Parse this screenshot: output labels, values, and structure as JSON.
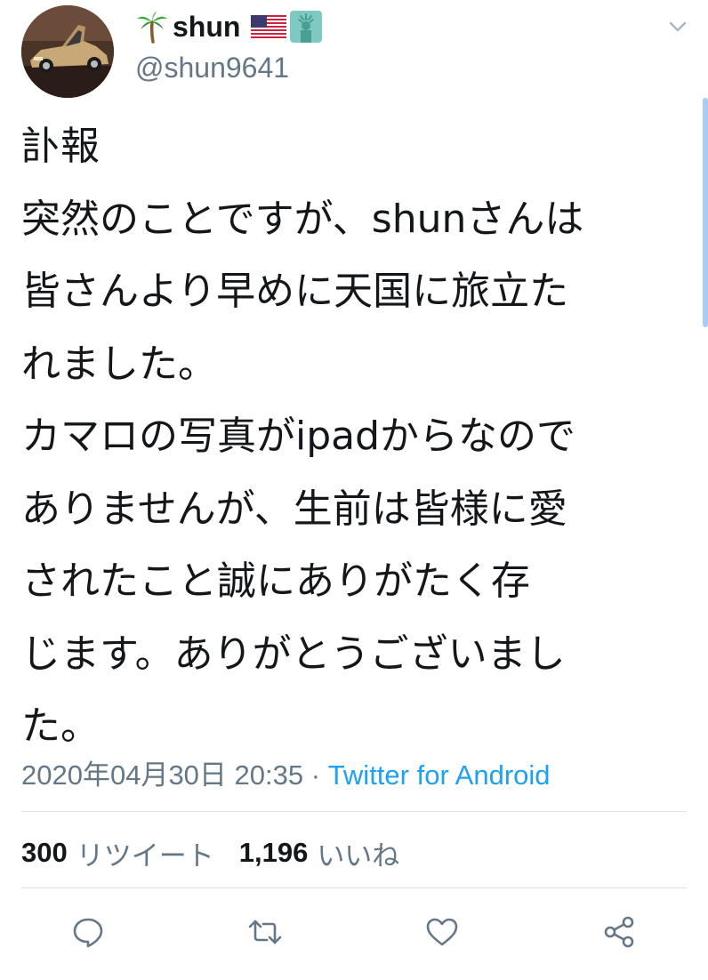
{
  "header": {
    "display_name": "shun",
    "handle": "@shun9641",
    "name_emoji": [
      "palm-tree",
      "us-flag",
      "statue-of-liberty"
    ]
  },
  "tweet": {
    "lines": [
      "訃報",
      "突然のことですが、shunさんは",
      "皆さんより早めに天国に旅立た",
      "れました。",
      "カマロの写真がipadからなので",
      "ありませんが、生前は皆様に愛",
      "されたこと誠にありがたく存",
      "じます。ありがとうございまし",
      "た。"
    ]
  },
  "meta": {
    "datetime": "2020年04月30日 20:35",
    "separator": " · ",
    "source": "Twitter for Android"
  },
  "stats": {
    "retweet_count": "300",
    "retweet_label": "リツイート",
    "like_count": "1,196",
    "like_label": "いいね"
  },
  "actions": [
    "reply-icon",
    "retweet-icon",
    "like-icon",
    "share-icon"
  ],
  "colors": {
    "text": "#14171a",
    "secondary": "#657786",
    "link": "#1da1f2",
    "divider": "#dfe3e7",
    "icon": "#657786"
  }
}
